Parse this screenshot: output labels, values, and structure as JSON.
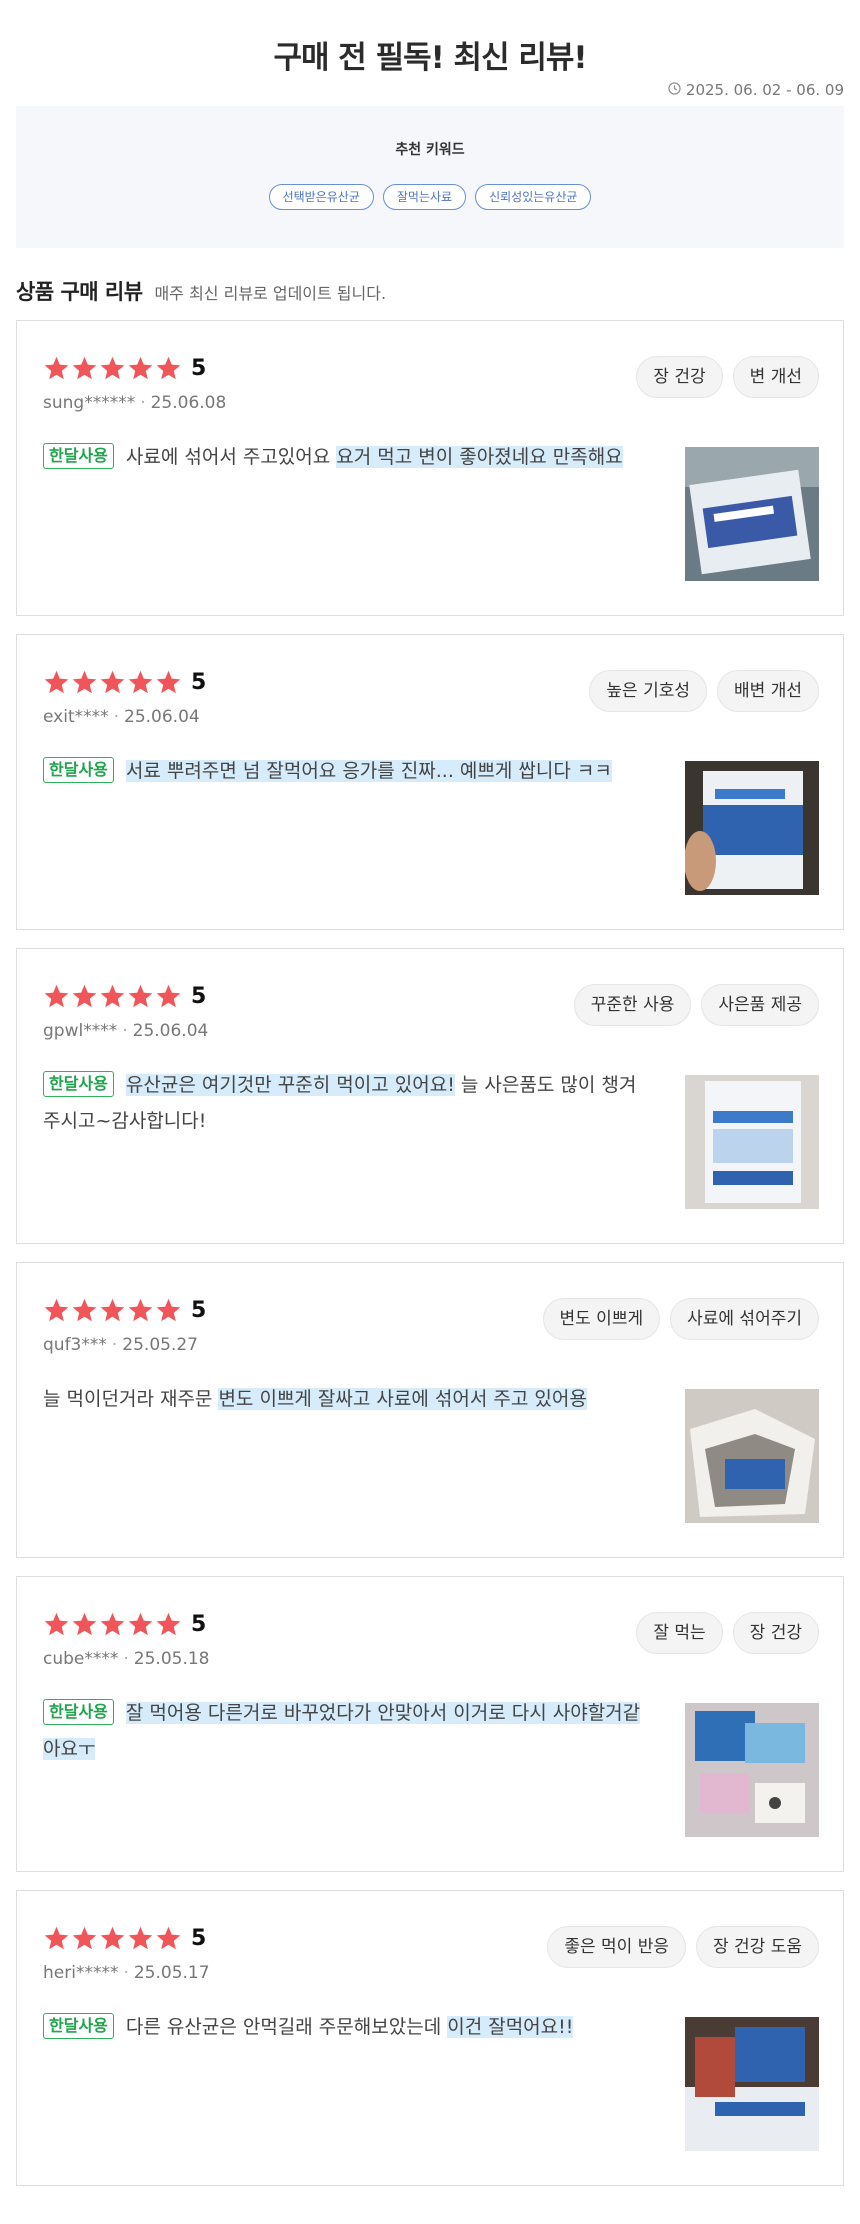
{
  "header": {
    "title": "구매 전 필독! 최신 리뷰!",
    "date_range": "2025. 06. 02 - 06. 09",
    "date_icon": "clock-icon"
  },
  "keywords": {
    "title": "추천 키워드",
    "items": [
      "선택받은유산균",
      "잘먹는사료",
      "신뢰성있는유산균"
    ]
  },
  "section": {
    "title": "상품 구매 리뷰",
    "subtitle": "매주 최신 리뷰로 업데이트 됩니다."
  },
  "colors": {
    "star": "#f0555a",
    "badge": "#21a24d",
    "highlight": "#d7ecfb",
    "keyword": "#4f74c6"
  },
  "reviews": [
    {
      "score": "5",
      "user": "sung******",
      "date": "25.06.08",
      "tags": [
        "장 건강",
        "변 개선"
      ],
      "badge": "한달사용",
      "text_plain": "사료에 섞어서 주고있어요 ",
      "text_highlight": "요거 먹고 변이 좋아졌네요 만족해요",
      "text_tail": ""
    },
    {
      "score": "5",
      "user": "exit****",
      "date": "25.06.04",
      "tags": [
        "높은 기호성",
        "배변 개선"
      ],
      "badge": "한달사용",
      "text_plain": "",
      "text_highlight": "서료 뿌려주면 넘 잘먹어요 응가를 진짜... 예쁘게 쌉니다 ㅋㅋ",
      "text_tail": ""
    },
    {
      "score": "5",
      "user": "gpwl****",
      "date": "25.06.04",
      "tags": [
        "꾸준한 사용",
        "사은품 제공"
      ],
      "badge": "한달사용",
      "text_plain": "",
      "text_highlight": "유산균은 여기것만 꾸준히 먹이고 있어요!",
      "text_tail": " 늘 사은품도 많이 챙겨주시고~감사합니다!"
    },
    {
      "score": "5",
      "user": "quf3***",
      "date": "25.05.27",
      "tags": [
        "변도 이쁘게",
        "사료에 섞어주기"
      ],
      "badge": "",
      "text_plain": "늘 먹이던거라 재주문 ",
      "text_highlight": "변도 이쁘게 잘싸고 사료에 섞어서 주고 있어용",
      "text_tail": ""
    },
    {
      "score": "5",
      "user": "cube****",
      "date": "25.05.18",
      "tags": [
        "잘 먹는",
        "장 건강"
      ],
      "badge": "한달사용",
      "text_plain": "",
      "text_highlight": "잘 먹어용 다른거로 바꾸었다가 안맞아서 이거로 다시 사야할거같아요ㅜ",
      "text_tail": ""
    },
    {
      "score": "5",
      "user": "heri*****",
      "date": "25.05.17",
      "tags": [
        "좋은 먹이 반응",
        "장 건강 도움"
      ],
      "badge": "한달사용",
      "text_plain": "다른 유산균은 안먹길래 주문해보았는데 ",
      "text_highlight": "이건 잘먹어요!!",
      "text_tail": ""
    }
  ]
}
